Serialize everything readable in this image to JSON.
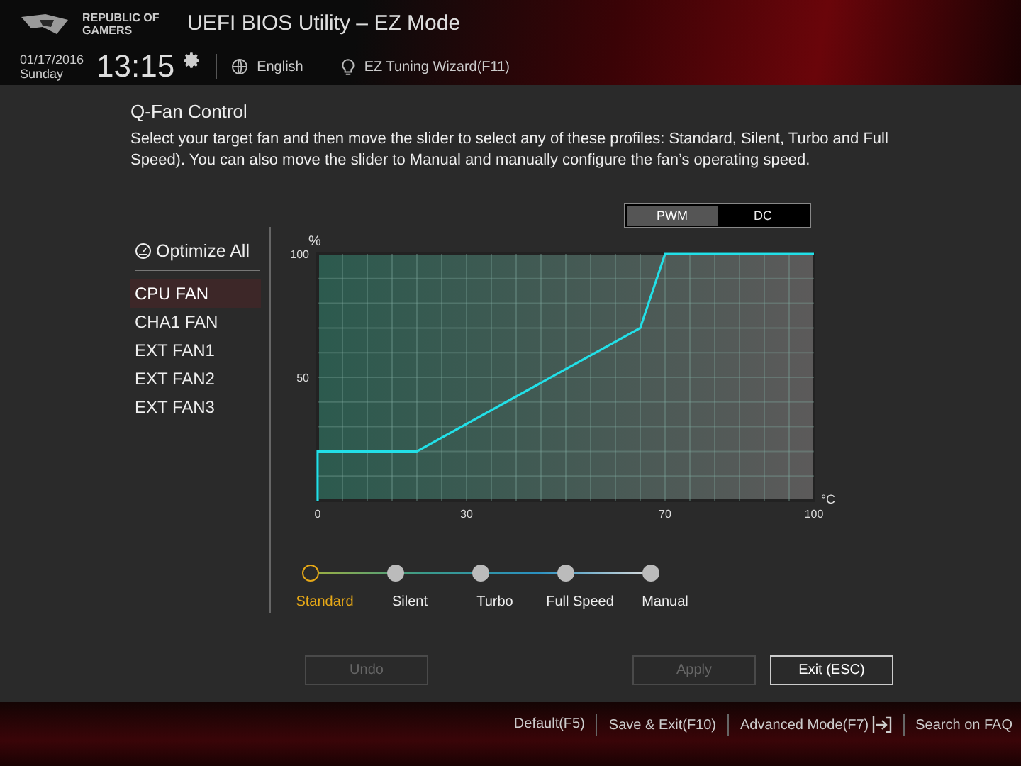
{
  "header": {
    "logo_text": [
      "REPUBLIC OF",
      "GAMERS"
    ],
    "title": "UEFI BIOS Utility – EZ Mode",
    "date": "01/17/2016",
    "day": "Sunday",
    "time": "13:15",
    "language": "English",
    "wizard": "EZ Tuning Wizard(F11)"
  },
  "qfan": {
    "title": "Q-Fan Control",
    "description": "Select your target fan and then move the slider to select any of these profiles: Standard, Silent, Turbo and Full Speed). You can also move the slider to Manual and manually configure the fan’s operating speed.",
    "mode_toggle": [
      {
        "label": "PWM",
        "selected": true
      },
      {
        "label": "DC",
        "selected": false
      }
    ],
    "optimize_all": "Optimize All",
    "fans": [
      {
        "label": "CPU FAN",
        "selected": true
      },
      {
        "label": "CHA1 FAN",
        "selected": false
      },
      {
        "label": "EXT FAN1",
        "selected": false
      },
      {
        "label": "EXT FAN2",
        "selected": false
      },
      {
        "label": "EXT FAN3",
        "selected": false
      }
    ],
    "chart_data": {
      "type": "line",
      "xlabel": "°C",
      "ylabel": "%",
      "x": [
        0,
        0,
        20,
        65,
        70,
        100
      ],
      "series": [
        {
          "color": "#22e0e8",
          "values": [
            0,
            20,
            20,
            70,
            100,
            100
          ]
        }
      ],
      "xlim": [
        0,
        100
      ],
      "ylim": [
        0,
        100
      ],
      "grid": true,
      "xticks": [
        0,
        30,
        70,
        100
      ],
      "yticks": [
        50,
        100
      ]
    },
    "profiles": [
      {
        "label": "Standard",
        "selected": true
      },
      {
        "label": "Silent",
        "selected": false
      },
      {
        "label": "Turbo",
        "selected": false
      },
      {
        "label": "Full Speed",
        "selected": false
      },
      {
        "label": "Manual",
        "selected": false
      }
    ]
  },
  "buttons": [
    {
      "label": "Undo",
      "disabled": true
    },
    {
      "label": "Apply",
      "disabled": true
    },
    {
      "label": "Exit (ESC)",
      "disabled": false
    }
  ],
  "footer": [
    {
      "label": "Default(F5)",
      "kind": "text"
    },
    {
      "label": "Save & Exit(F10)",
      "kind": "text"
    },
    {
      "label": "Advanced Mode(F7)",
      "kind": "exit-icon"
    },
    {
      "label": "Search on FAQ",
      "kind": "text"
    }
  ]
}
